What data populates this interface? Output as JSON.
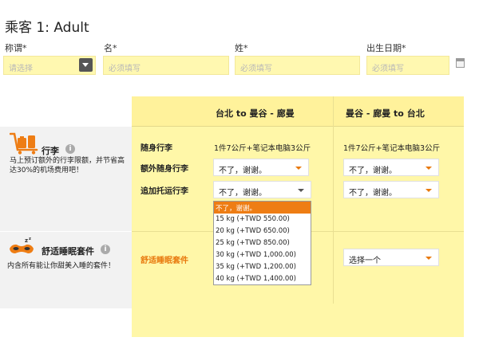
{
  "header": {
    "title": "乘客 1: Adult"
  },
  "form": {
    "honorific_label": "称谓*",
    "honorific_placeholder": "请选择",
    "first_name_label": "名*",
    "first_name_placeholder": "必须填写",
    "last_name_label": "姓*",
    "last_name_placeholder": "必须填写",
    "dob_label": "出生日期*",
    "dob_placeholder": "必须填写"
  },
  "columns": {
    "outbound": "台北 to 曼谷 - 廊曼",
    "return": "曼谷 - 廊曼 to 台北"
  },
  "baggage": {
    "title": "行李",
    "description": "马上预订额外的行李限额，并节省高达30%的机场费用吧！",
    "carry_on_label": "随身行李",
    "carry_on_outbound": "1件7公斤+笔记本电脑3公斤",
    "carry_on_return": "1件7公斤+笔记本电脑3公斤",
    "extra_carry_label": "额外随身行李",
    "extra_carry_outbound": "不了，谢谢。",
    "extra_carry_return": "不了，谢谢。",
    "checked_label": "追加托运行李",
    "checked_outbound": "不了，谢谢。",
    "checked_return": "不了，谢谢。",
    "options": [
      "不了，谢谢。",
      "15 kg (+TWD 550.00)",
      "20 kg (+TWD 650.00)",
      "25 kg (+TWD 850.00)",
      "30 kg (+TWD 1,000.00)",
      "35 kg (+TWD 1,200.00)",
      "40 kg (+TWD 1,400.00)"
    ]
  },
  "comfort": {
    "title": "舒适睡眠套件",
    "description": "内含所有能让你甜美入睡的套件！",
    "row_label": "舒适睡眠套件",
    "return_select": "选择一个"
  },
  "colors": {
    "accent": "#ee7d14",
    "yellow": "#fff7a8"
  },
  "icons": {
    "luggage": "luggage-cart-icon",
    "sleep": "sleep-mask-icon",
    "info": "info-icon",
    "calendar": "calendar-icon"
  }
}
